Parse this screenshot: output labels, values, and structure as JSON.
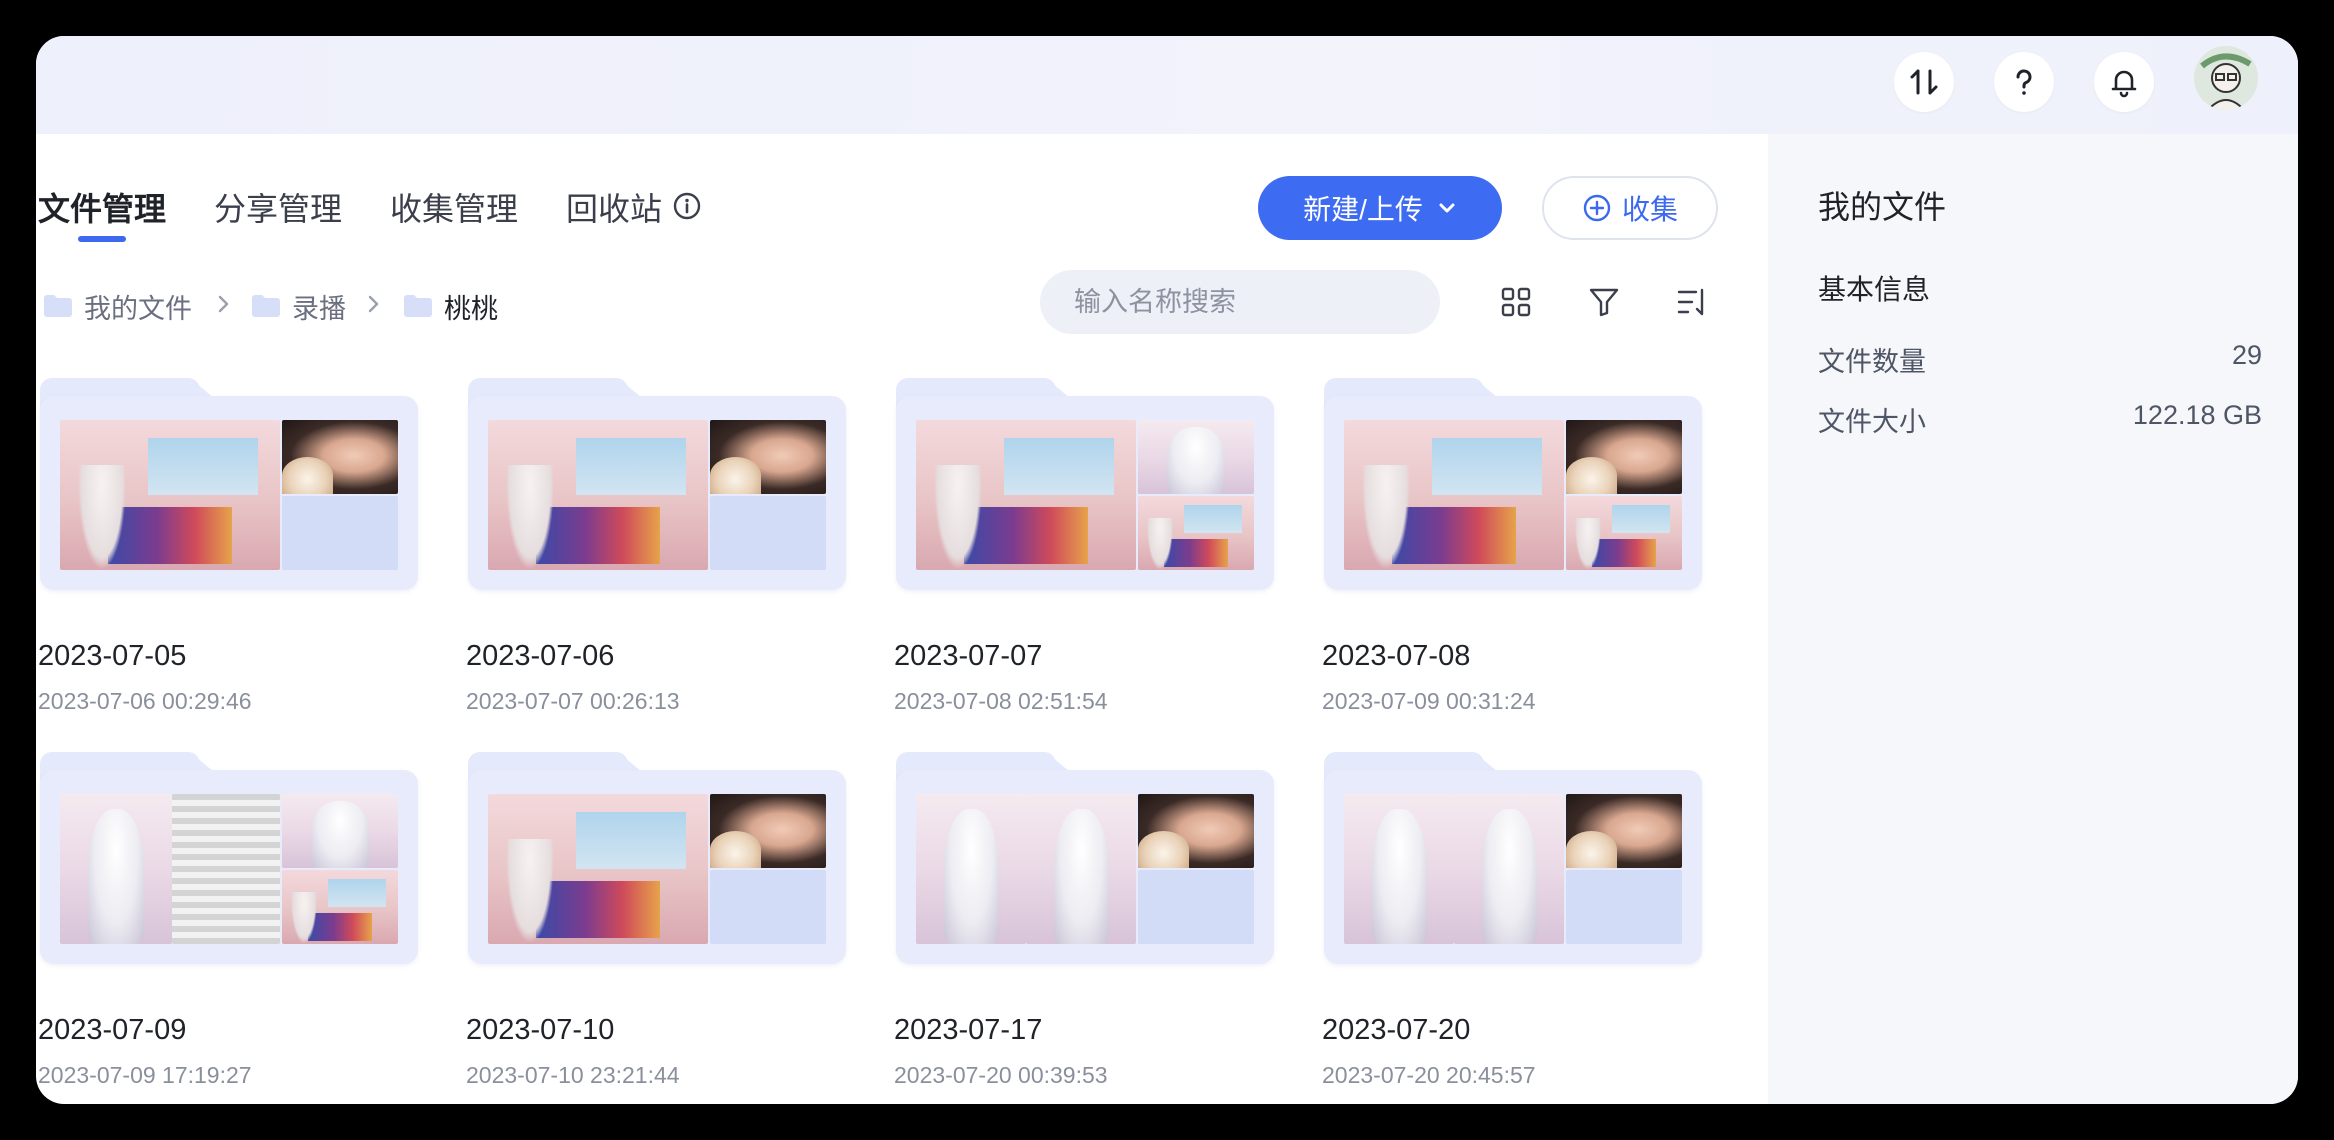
{
  "header": {
    "icons": [
      "transfer-icon",
      "help-icon",
      "bell-icon"
    ],
    "avatar_icon": "user-avatar"
  },
  "tabs": [
    {
      "label": "文件管理",
      "active": true
    },
    {
      "label": "分享管理",
      "active": false
    },
    {
      "label": "收集管理",
      "active": false
    },
    {
      "label": "回收站",
      "active": false
    }
  ],
  "toolbar": {
    "new_upload_label": "新建/上传",
    "collect_label": "收集"
  },
  "breadcrumb": [
    {
      "label": "我的文件"
    },
    {
      "label": "录播"
    },
    {
      "label": "桃桃"
    }
  ],
  "search": {
    "placeholder": "输入名称搜索"
  },
  "folders": [
    {
      "name": "2023-07-05",
      "date": "2023-07-06 00:29:46"
    },
    {
      "name": "2023-07-06",
      "date": "2023-07-07 00:26:13"
    },
    {
      "name": "2023-07-07",
      "date": "2023-07-08 02:51:54"
    },
    {
      "name": "2023-07-08",
      "date": "2023-07-09 00:31:24"
    },
    {
      "name": "2023-07-09",
      "date": "2023-07-09 17:19:27"
    },
    {
      "name": "2023-07-10",
      "date": "2023-07-10 23:21:44"
    },
    {
      "name": "2023-07-17",
      "date": "2023-07-20 00:39:53"
    },
    {
      "name": "2023-07-20",
      "date": "2023-07-20 20:45:57"
    }
  ],
  "sidebar": {
    "title": "我的文件",
    "section": "基本信息",
    "rows": [
      {
        "label": "文件数量",
        "value": "29"
      },
      {
        "label": "文件大小",
        "value": "122.18 GB"
      }
    ]
  },
  "colors": {
    "accent": "#3d6cf2",
    "folder": "#e7ebfb",
    "panel": "#f6f7fb"
  }
}
